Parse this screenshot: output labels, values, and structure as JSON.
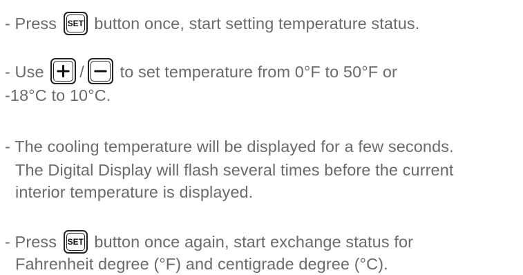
{
  "blocks": [
    {
      "lines": [
        {
          "before": "- Press",
          "button": "SET",
          "after": "button once, start setting temperature status."
        }
      ]
    },
    {
      "lines": [
        {
          "before": "- Use",
          "plus_icon": "plus-icon",
          "separator": "/",
          "minus_icon": "minus-icon",
          "after": "to set temperature from 0°F to 50°F or"
        },
        {
          "text": "-18°C to 10°C."
        }
      ]
    },
    {
      "lines": [
        {
          "text": "- The cooling temperature will be displayed for a few seconds."
        },
        {
          "text": "The Digital Display will flash several times before the current"
        },
        {
          "text": "interior temperature is displayed."
        }
      ]
    },
    {
      "lines": [
        {
          "before": "- Press",
          "button": "SET",
          "after": "button once again, start exchange status for"
        },
        {
          "text": "Fahrenheit degree (°F) and centigrade degree (°C)."
        }
      ]
    }
  ],
  "colors": {
    "text": "#6a6a6a",
    "button_outline": "#222222"
  }
}
